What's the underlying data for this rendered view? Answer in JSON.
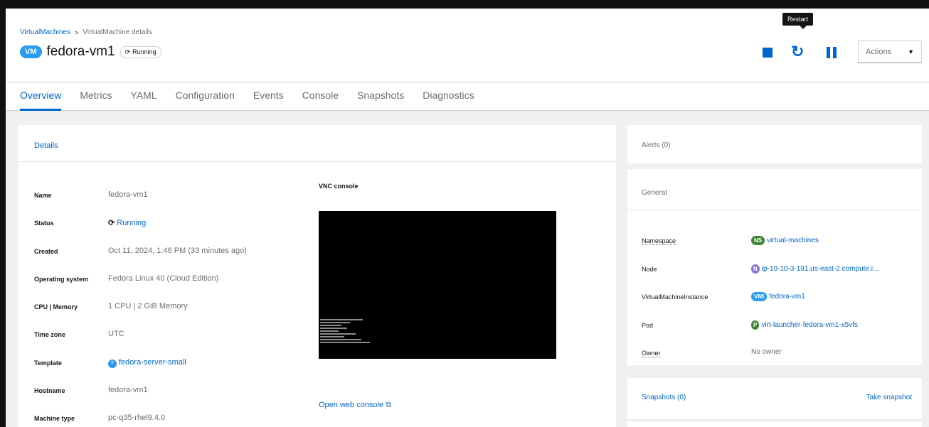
{
  "breadcrumb": {
    "root": "VirtualMachines",
    "separator": ">",
    "current": "VirtualMachine details"
  },
  "header": {
    "badge": "VM",
    "title": "fedora-vm1",
    "status": "Running"
  },
  "toolbar": {
    "tooltip": "Restart",
    "actions_label": "Actions"
  },
  "tabs": [
    "Overview",
    "Metrics",
    "YAML",
    "Configuration",
    "Events",
    "Console",
    "Snapshots",
    "Diagnostics"
  ],
  "details": {
    "heading": "Details",
    "rows": [
      {
        "label": "Name",
        "value": "fedora-vm1"
      },
      {
        "label": "Status",
        "value": "Running"
      },
      {
        "label": "Created",
        "value": "Oct 11, 2024, 1:46 PM (33 minutes ago)"
      },
      {
        "label": "Operating system",
        "value": "Fedora Linux 40 (Cloud Edition)"
      },
      {
        "label": "CPU | Memory",
        "value": "1 CPU | 2 GiB Memory"
      },
      {
        "label": "Time zone",
        "value": "UTC"
      },
      {
        "label": "Template",
        "value": "fedora-server-small",
        "badge": "T"
      },
      {
        "label": "Hostname",
        "value": "fedora-vm1"
      },
      {
        "label": "Machine type",
        "value": "pc-q35-rhel9.4.0"
      }
    ],
    "vnc_title": "VNC console",
    "open_web_console": "Open web console"
  },
  "alerts": {
    "label": "Alerts (0)"
  },
  "general": {
    "heading": "General",
    "rows": [
      {
        "label": "Namespace",
        "badge": "NS",
        "value": "virtual-machines"
      },
      {
        "label": "Node",
        "badge": "N",
        "value": "ip-10-10-3-191.us-east-2.compute.i..."
      },
      {
        "label": "VirtualMachineInstance",
        "badge": "VMI",
        "value": "fedora-vm1"
      },
      {
        "label": "Pod",
        "badge": "P",
        "value": "virt-launcher-fedora-vm1-x5vfs"
      },
      {
        "label": "Owner",
        "value": "No owner"
      }
    ]
  },
  "snapshots": {
    "title": "Snapshots (0)",
    "take": "Take snapshot"
  },
  "colors": {
    "accent": "#0066cc",
    "vm_badge": "#2b9af3",
    "ns_badge": "#3e8635",
    "node_badge": "#8476d1"
  }
}
